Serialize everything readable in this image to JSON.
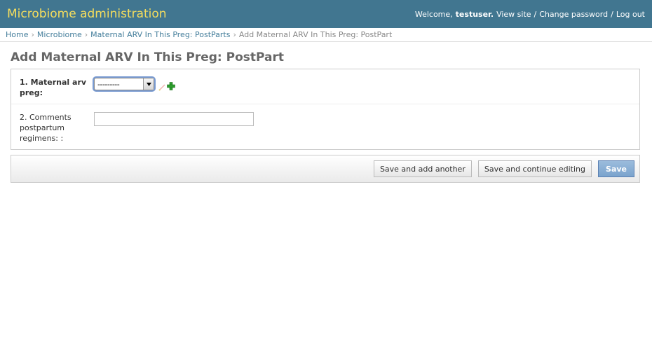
{
  "header": {
    "brand": "Microbiome administration",
    "welcome": "Welcome,",
    "username": "testuser.",
    "view_site": "View site",
    "change_password": "Change password",
    "log_out": "Log out",
    "sep": "/",
    "colors": {
      "bar": "#417690",
      "brand": "#f5dd5d"
    }
  },
  "breadcrumbs": {
    "items": [
      "Home",
      "Microbiome",
      "Maternal ARV In This Preg: PostParts"
    ],
    "current": "Add Maternal ARV In This Preg: PostPart",
    "arrow": "›"
  },
  "page": {
    "title": "Add Maternal ARV In This Preg: PostPart"
  },
  "form": {
    "rows": [
      {
        "label": "1. Maternal arv preg:",
        "type": "select",
        "value": "---------",
        "icons": [
          "edit-icon",
          "add-icon"
        ]
      },
      {
        "label": "2. Comments postpartum regimens: :",
        "type": "text",
        "value": ""
      }
    ]
  },
  "submit": {
    "save_add_another": "Save and add another",
    "save_continue": "Save and continue editing",
    "save": "Save"
  }
}
